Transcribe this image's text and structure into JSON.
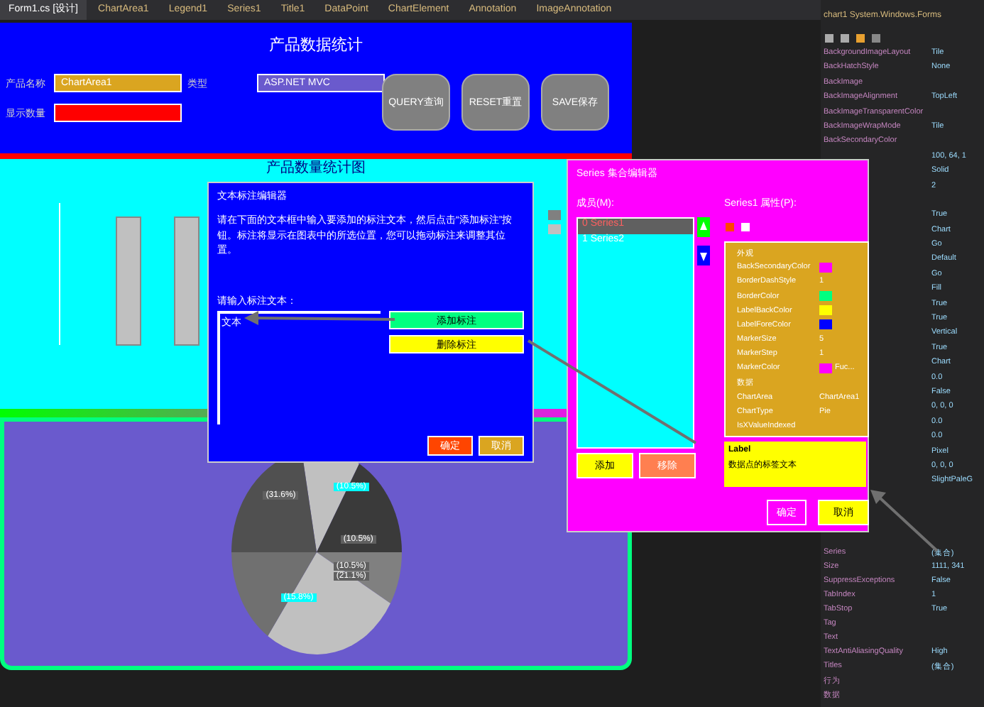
{
  "ide_tabs": [
    {
      "label": "Form1.cs [设计]",
      "selected": true
    },
    {
      "label": "ChartArea1",
      "selected": false
    },
    {
      "label": "Legend1",
      "selected": false
    },
    {
      "label": "Series1",
      "selected": false
    },
    {
      "label": "Title1",
      "selected": false
    },
    {
      "label": "DataPoint",
      "selected": false
    },
    {
      "label": "ChartElement",
      "selected": false
    },
    {
      "label": "Annotation",
      "selected": false
    },
    {
      "label": "ImageAnnotation",
      "selected": false
    }
  ],
  "form": {
    "title": "产品数据统计",
    "fields": [
      {
        "label": "产品名称",
        "value": "ChartArea1",
        "color": "#daa520"
      },
      {
        "label": "类型",
        "value": "ASP.NET MVC",
        "color": "#6a5acd"
      },
      {
        "label": "显示数量",
        "color": "#ff0000"
      }
    ],
    "buttons": [
      "QUERY查询",
      "RESET重置",
      "SAVE保存"
    ]
  },
  "chart_panel": {
    "title": "产品数量统计图",
    "legend": [
      {
        "color": "#808080"
      },
      {
        "color": "#c0c0c0"
      }
    ]
  },
  "pie_panel": {
    "labels": [
      "(31.6%)",
      "(10.5%)",
      "(10.5%)",
      "(10.5%)",
      "(15.8%)",
      "(21.1%)"
    ]
  },
  "annotation_dialog": {
    "title": "文本标注编辑器",
    "message": "请在下面的文本框中输入要添加的标注文本，然后点击“添加标注”按钮。标注将显示在图表中的所选位置，您可以拖动标注来调整其位置。",
    "prompt": "请输入标注文本：",
    "input_value": "文本",
    "actions": [
      "添加标注",
      "删除标注"
    ],
    "footer": [
      "确定",
      "取消"
    ]
  },
  "series_dialog": {
    "title": "Series 集合编辑器",
    "members_label": "成员(M):",
    "members": [
      {
        "index": "0",
        "label": "Series1",
        "selected": true
      },
      {
        "index": "1",
        "label": "Series2",
        "selected": false
      }
    ],
    "props_label": "Series1 属性(P):",
    "groups": [
      {
        "title": "外观",
        "rows": [
          {
            "kind": "swatch",
            "name": "BackSecondaryColor",
            "color": "#ff00ff"
          },
          {
            "kind": "text",
            "name": "BorderDashStyle",
            "value": "1"
          },
          {
            "kind": "swatch",
            "name": "BorderColor",
            "color": "#00ff80"
          },
          {
            "kind": "swatch",
            "name": "LabelBackColor",
            "color": "#ffff00"
          },
          {
            "kind": "swatch",
            "name": "LabelForeColor",
            "color": "#0000ff"
          },
          {
            "kind": "text",
            "name": "MarkerSize",
            "value": "5"
          },
          {
            "kind": "text",
            "name": "MarkerStep",
            "value": "1"
          },
          {
            "kind": "swatch",
            "name": "MarkerColor",
            "color": "#ff00ff",
            "value": "Fuc..."
          }
        ]
      },
      {
        "title": "数据",
        "rows": [
          {
            "kind": "text",
            "name": "ChartArea",
            "value": "ChartArea1"
          },
          {
            "kind": "text",
            "name": "ChartType",
            "value": "Pie"
          },
          {
            "kind": "text",
            "name": "IsXValueIndexed",
            "value": ""
          }
        ]
      }
    ],
    "desc_title": "Label",
    "desc_text": "数据点的标签文本",
    "add": "添加",
    "remove": "移除",
    "ok": "确定",
    "cancel": "取消"
  },
  "properties": {
    "header": "chart1 System.Windows.Forms",
    "rows": [
      {
        "name": "BackgroundImageLayout",
        "value": "Tile"
      },
      {
        "name": "BackHatchStyle",
        "value": "None"
      },
      {
        "name": "BackImage"
      },
      {
        "name": "BackImageAlignment",
        "value": "TopLeft"
      },
      {
        "name": "BackImageTransparentColor"
      },
      {
        "name": "BackImageWrapMode",
        "value": "Tile"
      },
      {
        "name": "BackSecondaryColor"
      },
      {
        "value": "100, 64, 1"
      },
      {
        "value": "Solid"
      },
      {
        "value": "2"
      },
      {},
      {
        "value": "True"
      },
      {
        "value": "Chart"
      },
      {
        "value": "Go"
      },
      {
        "value": "Default"
      },
      {
        "value": "Go"
      },
      {
        "value": "Fill"
      },
      {
        "value": "True"
      },
      {
        "value": "True"
      },
      {
        "value": "Vertical"
      },
      {
        "value": "True"
      },
      {
        "value": "Chart"
      },
      {
        "value": "0.0"
      },
      {
        "value": "False"
      },
      {
        "value": "0, 0, 0"
      },
      {
        "value": "0.0"
      },
      {
        "value": "0.0"
      },
      {
        "value": "Pixel"
      },
      {
        "value": "0, 0, 0"
      },
      {
        "value": "SlightPaleG"
      },
      {},
      {},
      {
        "name": "Series",
        "value": "(集合)"
      },
      {
        "name": "Size",
        "value": "1111, 341"
      },
      {
        "name": "SuppressExceptions",
        "value": "False"
      },
      {
        "name": "TabIndex",
        "value": "1"
      },
      {
        "name": "TabStop",
        "value": "True"
      },
      {
        "name": "Tag"
      },
      {
        "name": "Text"
      },
      {
        "name": "TextAntiAliasingQuality",
        "value": "High"
      },
      {
        "name": "Titles",
        "value": "(集合)"
      },
      {
        "name": "行为"
      },
      {
        "name": "数据"
      }
    ]
  }
}
